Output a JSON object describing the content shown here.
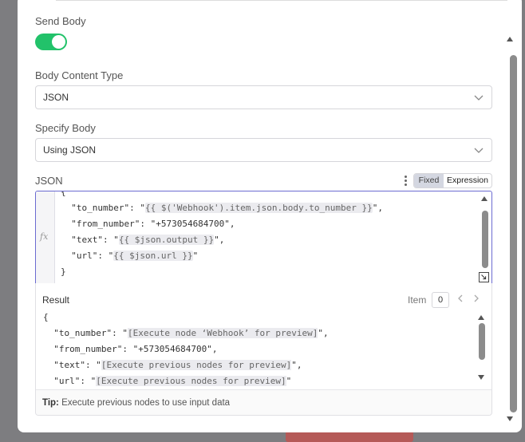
{
  "send_body": {
    "label": "Send Body",
    "enabled": true,
    "accent": "#22c26a"
  },
  "body_content_type": {
    "label": "Body Content Type",
    "value": "JSON"
  },
  "specify_body": {
    "label": "Specify Body",
    "value": "Using JSON"
  },
  "json_field": {
    "label": "JSON",
    "mode_fixed": "Fixed",
    "mode_expression": "Expression",
    "active_mode": "Expression",
    "fx_label": "fx",
    "lines": [
      {
        "pre": "{",
        "expr": "",
        "post": ""
      },
      {
        "pre": "  \"to_number\": \"",
        "expr": "{{ $('Webhook').item.json.body.to_number }}",
        "post": "\","
      },
      {
        "pre": "  \"from_number\": \"+573054684700\",",
        "expr": "",
        "post": ""
      },
      {
        "pre": "  \"text\": \"",
        "expr": "{{ $json.output }}",
        "post": "\","
      },
      {
        "pre": "  \"url\": \"",
        "expr": "{{ $json.url }}",
        "post": "\""
      },
      {
        "pre": "}",
        "expr": "",
        "post": ""
      }
    ]
  },
  "result": {
    "title": "Result",
    "item_label": "Item",
    "item_index": "0",
    "lines": [
      {
        "pre": "{",
        "expr": "",
        "post": ""
      },
      {
        "pre": "  \"to_number\": \"",
        "expr": "[Execute node ‘Webhook’ for preview]",
        "post": "\","
      },
      {
        "pre": "  \"from_number\": \"+573054684700\",",
        "expr": "",
        "post": ""
      },
      {
        "pre": "  \"text\": \"",
        "expr": "[Execute previous nodes for preview]",
        "post": "\","
      },
      {
        "pre": "  \"url\": \"",
        "expr": "[Execute previous nodes for preview]",
        "post": "\""
      }
    ],
    "tip_label": "Tip:",
    "tip_text": "Execute previous nodes to use input data"
  },
  "icons": {
    "dropdown": "chevron-down-icon",
    "options": "vertical-dots-icon",
    "resize": "expand-icon",
    "prev": "chevron-left-icon",
    "next": "chevron-right-icon"
  }
}
